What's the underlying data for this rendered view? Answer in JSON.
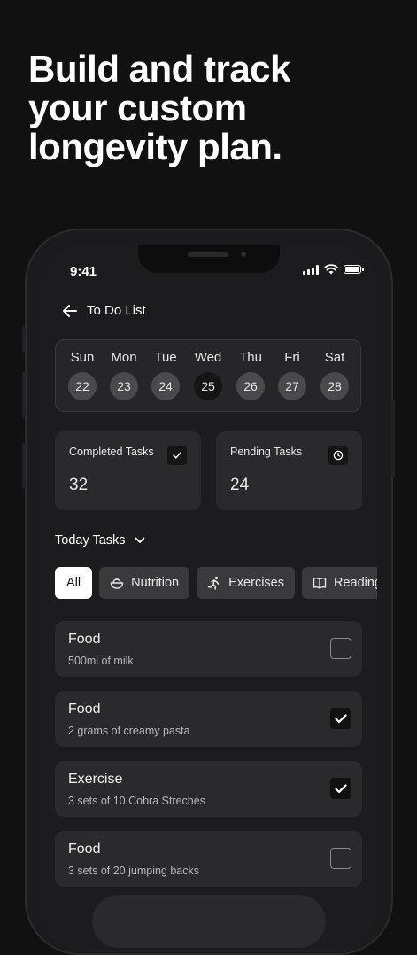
{
  "headline": [
    "Build and track",
    "your custom",
    "longevity plan."
  ],
  "status": {
    "time": "9:41"
  },
  "nav": {
    "title": "To Do List"
  },
  "week": [
    {
      "name": "Sun",
      "num": "22"
    },
    {
      "name": "Mon",
      "num": "23"
    },
    {
      "name": "Tue",
      "num": "24"
    },
    {
      "name": "Wed",
      "num": "25",
      "active": true
    },
    {
      "name": "Thu",
      "num": "26"
    },
    {
      "name": "Fri",
      "num": "27"
    },
    {
      "name": "Sat",
      "num": "28"
    }
  ],
  "stats": {
    "completed": {
      "label": "Completed Tasks",
      "value": "32",
      "icon": "check-icon"
    },
    "pending": {
      "label": "Pending Tasks",
      "value": "24",
      "icon": "clock-icon"
    }
  },
  "today": {
    "label": "Today Tasks"
  },
  "filters": [
    {
      "label": "All",
      "active": true
    },
    {
      "label": "Nutrition",
      "icon": "bowl-icon"
    },
    {
      "label": "Exercises",
      "icon": "runner-icon"
    },
    {
      "label": "Reading",
      "icon": "book-icon"
    }
  ],
  "tasks": [
    {
      "name": "Food",
      "desc": "500ml of milk",
      "done": false
    },
    {
      "name": "Food",
      "desc": "2 grams of creamy pasta",
      "done": true
    },
    {
      "name": "Exercise",
      "desc": "3 sets of 10 Cobra Streches",
      "done": true
    },
    {
      "name": "Food",
      "desc": "3 sets of 20 jumping backs",
      "done": false
    }
  ],
  "colors": {
    "background": "#111111",
    "screen": "#1c1c1e",
    "card": "#2a2a2c",
    "chip": "#3a3a3d"
  }
}
